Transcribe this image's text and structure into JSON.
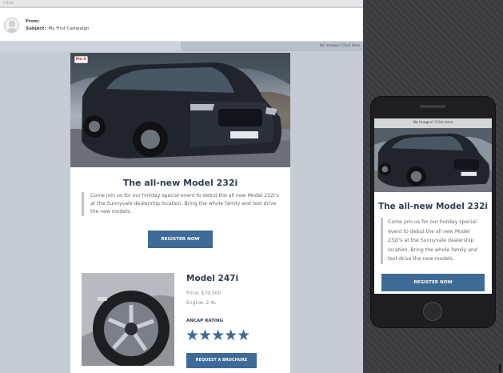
{
  "window": {
    "title": "Inbox"
  },
  "header": {
    "from_label": "From:",
    "from_value": "",
    "subject_label": "Subject:",
    "subject_value": "My First Campaign"
  },
  "toolbar": {
    "images_link": "No images? Click here"
  },
  "email": {
    "pin_label": "Pin it",
    "hero_title": "The all-new Model 232i",
    "hero_text": "Come join us for our holiday special event to debut the all new Model 232i's at the Sunnyvale dealership location. Bring the whole family and test drive the new models.",
    "register_label": "REGISTER NOW",
    "product_title": "Model 247i",
    "price": "Price: $70,500",
    "engine": "Engine: 2.4L",
    "rating_label": "ANCAP RATING",
    "rating_value": 5,
    "rating_max": 5,
    "stars": "★★★★★",
    "brochure_label": "REQUEST A BROCHURE"
  },
  "mobile_preview": {
    "images_link": "No Images? Click here",
    "hero_title": "The all-new Model 232i",
    "hero_text": "Come join us for our holiday special event to debut the all new Model 232i's at the Sunnyvale dealership location. Bring the whole family and test drive the new models.",
    "register_label": "REGISTER NOW"
  },
  "colors": {
    "accent": "#3d6a96",
    "title": "#2e3f54",
    "canvas": "#c5ccd4",
    "phone": "#1d1e22"
  }
}
